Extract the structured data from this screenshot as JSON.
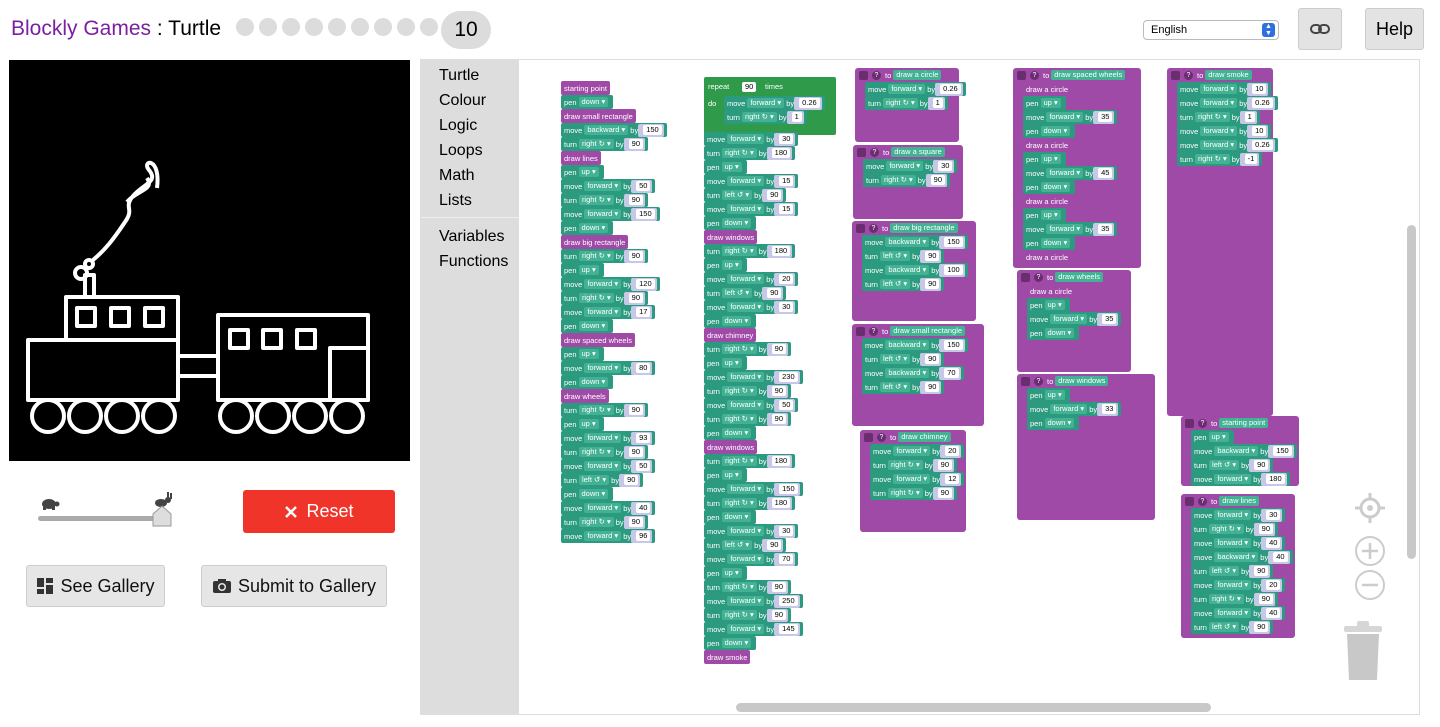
{
  "header": {
    "site": "Blockly Games",
    "separator": " : ",
    "game": "Turtle",
    "level_count": 9,
    "current_level": "10",
    "language": "English",
    "help": "Help"
  },
  "controls": {
    "reset": "Reset",
    "see_gallery": "See Gallery",
    "submit_gallery": "Submit to Gallery",
    "speed": 1.0
  },
  "toolbox": {
    "group1": [
      "Turtle",
      "Colour",
      "Logic",
      "Loops",
      "Math",
      "Lists"
    ],
    "group2": [
      "Variables",
      "Functions"
    ]
  },
  "colors": {
    "turtle_block": "#2c9a7e",
    "procedure_block": "#a04aa8",
    "loop_block": "#2e9a4a",
    "reset": "#f0342a",
    "site_title": "#7b1fa2"
  },
  "blocks": {
    "col1": [
      [
        "c",
        "starting point"
      ],
      [
        "p",
        "pen",
        "down"
      ],
      [
        "c",
        "draw small rectangle"
      ],
      [
        "m",
        "move",
        "backward",
        "150"
      ],
      [
        "t",
        "turn",
        "right ↻",
        "90"
      ],
      [
        "c",
        "draw lines"
      ],
      [
        "p",
        "pen",
        "up"
      ],
      [
        "m",
        "move",
        "forward",
        "50"
      ],
      [
        "t",
        "turn",
        "right ↻",
        "90"
      ],
      [
        "m",
        "move",
        "forward",
        "150"
      ],
      [
        "p",
        "pen",
        "down"
      ],
      [
        "c",
        "draw big rectangle"
      ],
      [
        "t",
        "turn",
        "right ↻",
        "90"
      ],
      [
        "p",
        "pen",
        "up"
      ],
      [
        "m",
        "move",
        "forward",
        "120"
      ],
      [
        "t",
        "turn",
        "right ↻",
        "90"
      ],
      [
        "m",
        "move",
        "forward",
        "17"
      ],
      [
        "p",
        "pen",
        "down"
      ],
      [
        "c",
        "draw spaced wheels"
      ],
      [
        "p",
        "pen",
        "up"
      ],
      [
        "m",
        "move",
        "forward",
        "80"
      ],
      [
        "p",
        "pen",
        "down"
      ],
      [
        "c",
        "draw wheels"
      ],
      [
        "t",
        "turn",
        "right ↻",
        "90"
      ],
      [
        "p",
        "pen",
        "up"
      ],
      [
        "m",
        "move",
        "forward",
        "93"
      ],
      [
        "t",
        "turn",
        "right ↻",
        "90"
      ],
      [
        "m",
        "move",
        "forward",
        "50"
      ],
      [
        "t",
        "turn",
        "left ↺",
        "90"
      ],
      [
        "p",
        "pen",
        "down"
      ],
      [
        "m",
        "move",
        "forward",
        "40"
      ],
      [
        "t",
        "turn",
        "right ↻",
        "90"
      ],
      [
        "m",
        "move",
        "forward",
        "96"
      ]
    ],
    "col2_repeat": {
      "repeat": "repeat",
      "count": "90",
      "times": "times",
      "do": "do"
    },
    "col2_inner": [
      [
        "m",
        "move",
        "forward",
        "0.26"
      ],
      [
        "t",
        "turn",
        "right ↻",
        "1"
      ]
    ],
    "col2": [
      [
        "m",
        "move",
        "forward",
        "30"
      ],
      [
        "t",
        "turn",
        "right ↻",
        "180"
      ],
      [
        "p",
        "pen",
        "up"
      ],
      [
        "m",
        "move",
        "forward",
        "15"
      ],
      [
        "t",
        "turn",
        "left ↺",
        "90"
      ],
      [
        "m",
        "move",
        "forward",
        "15"
      ],
      [
        "p",
        "pen",
        "down"
      ],
      [
        "c",
        "draw windows"
      ],
      [
        "t",
        "turn",
        "right ↻",
        "180"
      ],
      [
        "p",
        "pen",
        "up"
      ],
      [
        "m",
        "move",
        "forward",
        "20"
      ],
      [
        "t",
        "turn",
        "left ↺",
        "90"
      ],
      [
        "m",
        "move",
        "forward",
        "30"
      ],
      [
        "p",
        "pen",
        "down"
      ],
      [
        "c",
        "draw chimney"
      ],
      [
        "t",
        "turn",
        "right ↻",
        "90"
      ],
      [
        "p",
        "pen",
        "up"
      ],
      [
        "m",
        "move",
        "forward",
        "230"
      ],
      [
        "t",
        "turn",
        "right ↻",
        "90"
      ],
      [
        "m",
        "move",
        "forward",
        "50"
      ],
      [
        "t",
        "turn",
        "right ↻",
        "90"
      ],
      [
        "p",
        "pen",
        "down"
      ],
      [
        "c",
        "draw windows"
      ],
      [
        "t",
        "turn",
        "right ↻",
        "180"
      ],
      [
        "p",
        "pen",
        "up"
      ],
      [
        "m",
        "move",
        "forward",
        "150"
      ],
      [
        "t",
        "turn",
        "right ↻",
        "180"
      ],
      [
        "p",
        "pen",
        "down"
      ],
      [
        "m",
        "move",
        "forward",
        "30"
      ],
      [
        "t",
        "turn",
        "left ↺",
        "90"
      ],
      [
        "m",
        "move",
        "forward",
        "70"
      ],
      [
        "p",
        "pen",
        "up"
      ],
      [
        "t",
        "turn",
        "right ↻",
        "90"
      ],
      [
        "m",
        "move",
        "forward",
        "250"
      ],
      [
        "t",
        "turn",
        "right ↻",
        "90"
      ],
      [
        "m",
        "move",
        "forward",
        "145"
      ],
      [
        "p",
        "pen",
        "down"
      ],
      [
        "c",
        "draw smoke"
      ]
    ],
    "procs": {
      "to": "to",
      "circle": "draw a circle",
      "square": "draw a square",
      "bigrect": "draw big rectangle",
      "smallrect": "draw small rectangle",
      "chimney": "draw chimney",
      "spaced": "draw spaced wheels",
      "wheels": "draw wheels",
      "windows": "draw windows",
      "smoke": "draw smoke",
      "start": "starting point",
      "lines": "draw lines"
    }
  }
}
